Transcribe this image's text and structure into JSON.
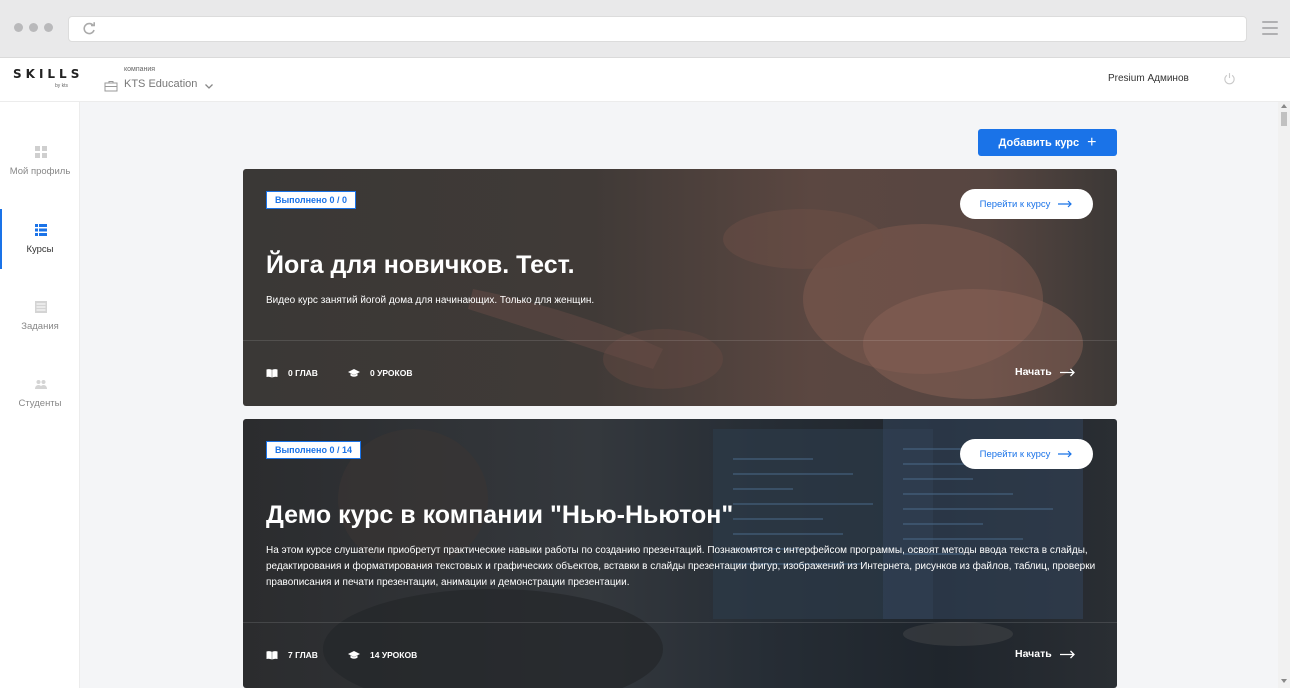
{
  "app": {
    "logo": "SKILLS",
    "logo_sub": "by kts"
  },
  "company": {
    "caption": "компания",
    "name": "KTS Education"
  },
  "user": {
    "name": "Presium Админов"
  },
  "sidebar": {
    "items": [
      {
        "label": "Мой профиль",
        "icon": "dashboard-icon",
        "active": false
      },
      {
        "label": "Курсы",
        "icon": "list-icon",
        "active": true
      },
      {
        "label": "Задания",
        "icon": "tasks-icon",
        "active": false
      },
      {
        "label": "Студенты",
        "icon": "users-icon",
        "active": false
      }
    ]
  },
  "actions": {
    "add_course": "Добавить курс",
    "add_icon": "+"
  },
  "courses": [
    {
      "progress": "Выполнено 0 / 0",
      "goto_label": "Перейти к курсу",
      "title": "Йога для новичков. Тест.",
      "description": "Видео курс занятий йогой дома для начинающих. Только для женщин.",
      "chapters": "0 ГЛАВ",
      "lessons": "0 УРОКОВ",
      "start_label": "Начать"
    },
    {
      "progress": "Выполнено 0 / 14",
      "goto_label": "Перейти к курсу",
      "title": "Демо курс в компании \"Нью-Ньютон\"",
      "description": "На этом курсе слушатели приобретут практические навыки работы по созданию презентаций. Познакомятся с интерфейсом программы, освоят методы ввода текста в слайды, редактирования и форматирования текстовых и графических объектов, вставки в слайды презентации фигур, изображений из Интернета, рисунков из файлов, таблиц, проверки правописания и печати презентации, анимации и демонстрации презентации.",
      "chapters": "7 ГЛАВ",
      "lessons": "14 УРОКОВ",
      "start_label": "Начать"
    }
  ],
  "colors": {
    "accent": "#1a73e8",
    "sidebar_bg": "#ffffff",
    "page_bg": "#f4f5f7"
  }
}
